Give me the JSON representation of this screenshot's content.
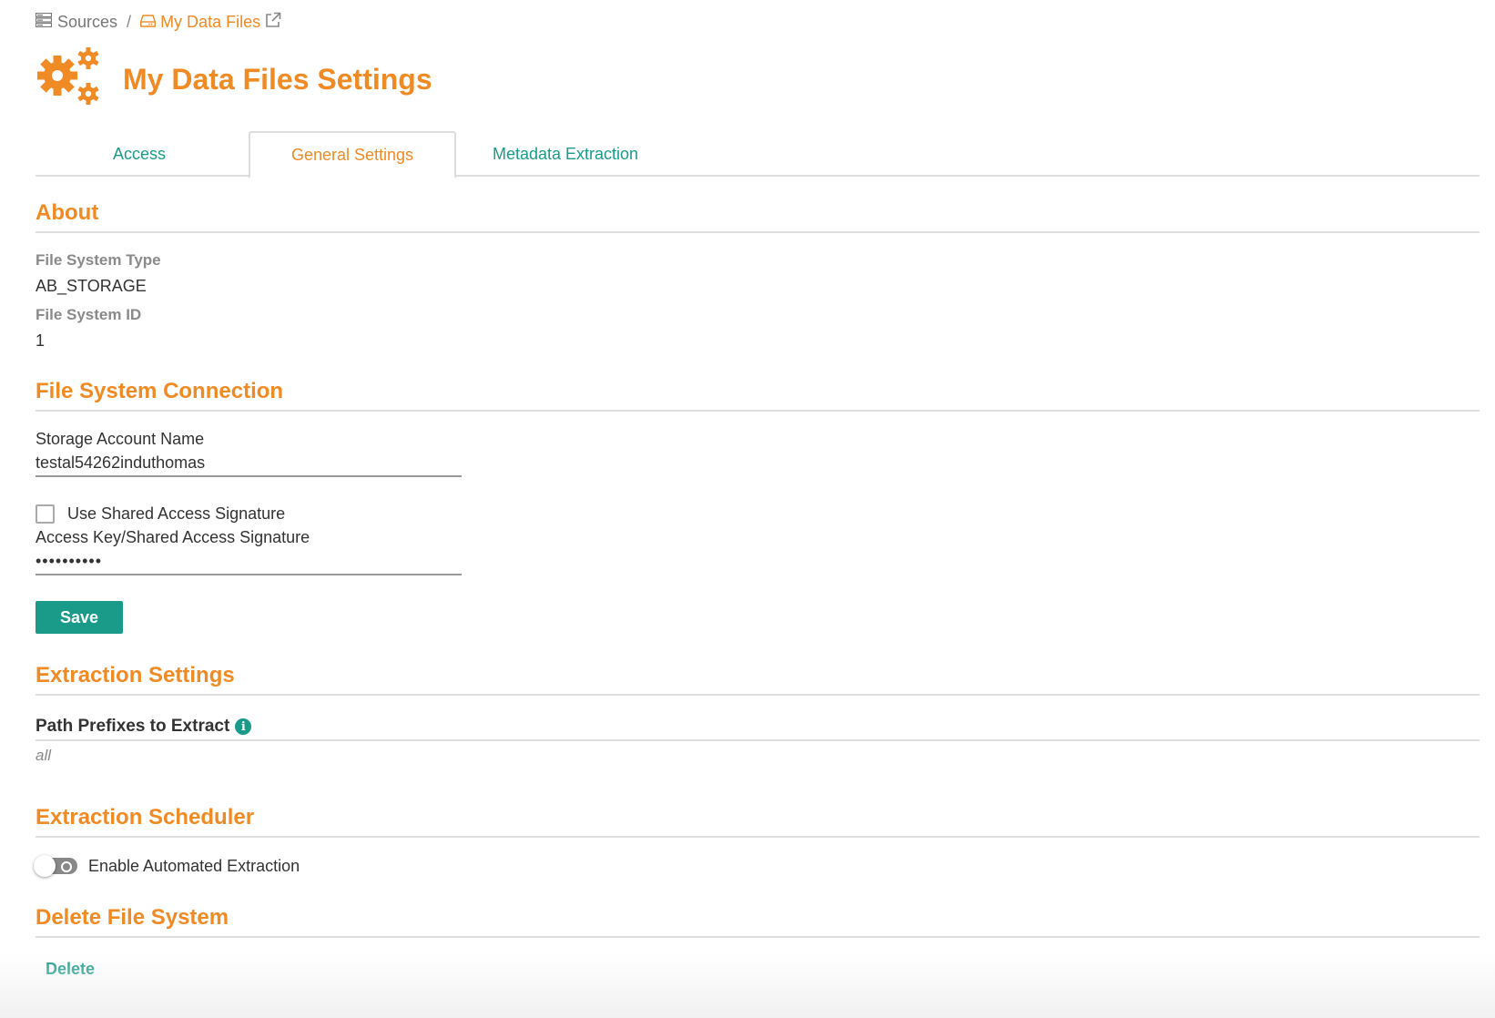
{
  "breadcrumb": {
    "sources_icon": "server-icon",
    "sources_label": "Sources",
    "separator": "/",
    "current_icon": "drive-icon",
    "current_label": "My Data Files",
    "external_icon": "external-link-icon"
  },
  "header": {
    "icon": "gears-icon",
    "title": "My Data Files Settings"
  },
  "tabs": [
    {
      "label": "Access",
      "active": false
    },
    {
      "label": "General Settings",
      "active": true
    },
    {
      "label": "Metadata Extraction",
      "active": false
    }
  ],
  "about": {
    "title": "About",
    "fs_type_label": "File System Type",
    "fs_type_value": "AB_STORAGE",
    "fs_id_label": "File System ID",
    "fs_id_value": "1"
  },
  "connection": {
    "title": "File System Connection",
    "storage_label": "Storage Account Name",
    "storage_value": "testal54262induthomas",
    "sas_checkbox_label": "Use Shared Access Signature",
    "sas_checked": false,
    "key_label": "Access Key/Shared Access Signature",
    "key_value": "••••••••••",
    "save_label": "Save"
  },
  "extraction": {
    "title": "Extraction Settings",
    "prefix_label": "Path Prefixes to Extract",
    "prefix_icon": "info-icon",
    "prefix_value": "all"
  },
  "scheduler": {
    "title": "Extraction Scheduler",
    "toggle_label": "Enable Automated Extraction",
    "enabled": false
  },
  "delete_section": {
    "title": "Delete File System",
    "delete_label": "Delete"
  },
  "colors": {
    "accent_orange": "#f08a24",
    "accent_teal": "#1a9b8a",
    "divider": "#dddddd"
  }
}
